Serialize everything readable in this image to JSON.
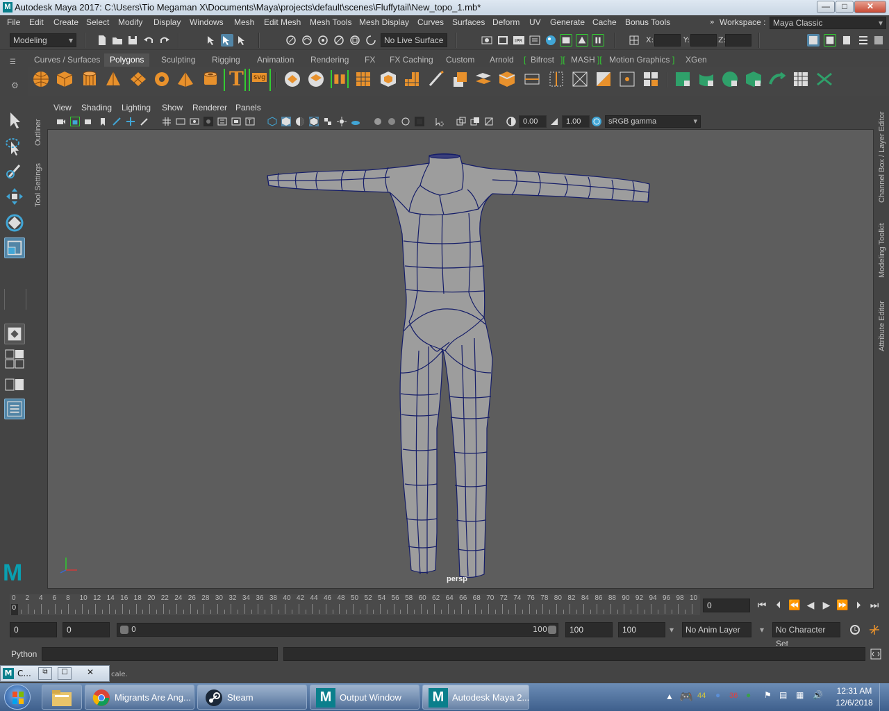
{
  "window": {
    "title": "Autodesk Maya 2017: C:\\Users\\Tio Megaman X\\Documents\\Maya\\projects\\default\\scenes\\Fluffytail\\New_topo_1.mb*",
    "logo": "M",
    "minimize": "—",
    "maximize": "□",
    "close": "✕"
  },
  "menu": {
    "items": [
      "File",
      "Edit",
      "Create",
      "Select",
      "Modify",
      "Display",
      "Windows",
      "Mesh",
      "Edit Mesh",
      "Mesh Tools",
      "Mesh Display",
      "Curves",
      "Surfaces",
      "Deform",
      "UV",
      "Generate",
      "Cache",
      "Bonus Tools"
    ],
    "workspace_label": "Workspace :",
    "workspace_value": "Maya Classic"
  },
  "status": {
    "menuset": "Modeling",
    "live_surface": "No Live Surface",
    "x_label": "X:",
    "y_label": "Y:",
    "z_label": "Z:"
  },
  "shelf": {
    "tabs": [
      "Curves / Surfaces",
      "Polygons",
      "Sculpting",
      "Rigging",
      "Animation",
      "Rendering",
      "FX",
      "FX Caching",
      "Custom",
      "Arnold",
      "Bifrost",
      "MASH",
      "Motion Graphics",
      "XGen"
    ],
    "active_tab": "Polygons",
    "text_icon": "T",
    "svg_icon": "svg"
  },
  "left_tabs": [
    "Outliner",
    "Tool Settings"
  ],
  "right_tabs": [
    "Channel Box / Layer Editor",
    "Modeling Toolkit",
    "Attribute Editor"
  ],
  "viewport": {
    "menus": [
      "View",
      "Shading",
      "Lighting",
      "Show",
      "Renderer",
      "Panels"
    ],
    "exposure": "0.00",
    "gamma": "1.00",
    "color_space": "sRGB gamma",
    "camera_label": "persp"
  },
  "timeline": {
    "ticks": [
      "0",
      "2",
      "4",
      "6",
      "8",
      "10",
      "12",
      "14",
      "16",
      "18",
      "20",
      "22",
      "24",
      "26",
      "28",
      "30",
      "32",
      "34",
      "36",
      "38",
      "40",
      "42",
      "44",
      "46",
      "48",
      "50",
      "52",
      "54",
      "56",
      "58",
      "60",
      "62",
      "64",
      "66",
      "68",
      "70",
      "72",
      "74",
      "76",
      "78",
      "80",
      "82",
      "84",
      "86",
      "88",
      "90",
      "92",
      "94",
      "96",
      "98",
      "10"
    ],
    "current_frame_marker": "0",
    "current_frame": "0"
  },
  "range": {
    "start": "0",
    "playback_start": "0",
    "slider_min": "0",
    "slider_max": "100",
    "playback_end": "100",
    "end": "100",
    "anim_layer": "No Anim Layer",
    "char_set": "No Character Set"
  },
  "command": {
    "language": "Python"
  },
  "help": {
    "mini_title": "C...",
    "text": "cale."
  },
  "taskbar": {
    "apps": [
      {
        "label": "Migrants Are Ang..."
      },
      {
        "label": "Steam"
      },
      {
        "label": "Output Window"
      },
      {
        "label": "Autodesk Maya 2..."
      }
    ],
    "tray_num1": "44",
    "tray_num2": "36",
    "time": "12:31 AM",
    "date": "12/6/2018"
  },
  "colors": {
    "maya_teal": "#0a7f8c",
    "mesh_fill": "#9d9d9d",
    "wire": "#151d68",
    "shelf_orange": "#e8912c",
    "shelf_green": "#2fa06a",
    "bracket_green": "#33cc33"
  }
}
